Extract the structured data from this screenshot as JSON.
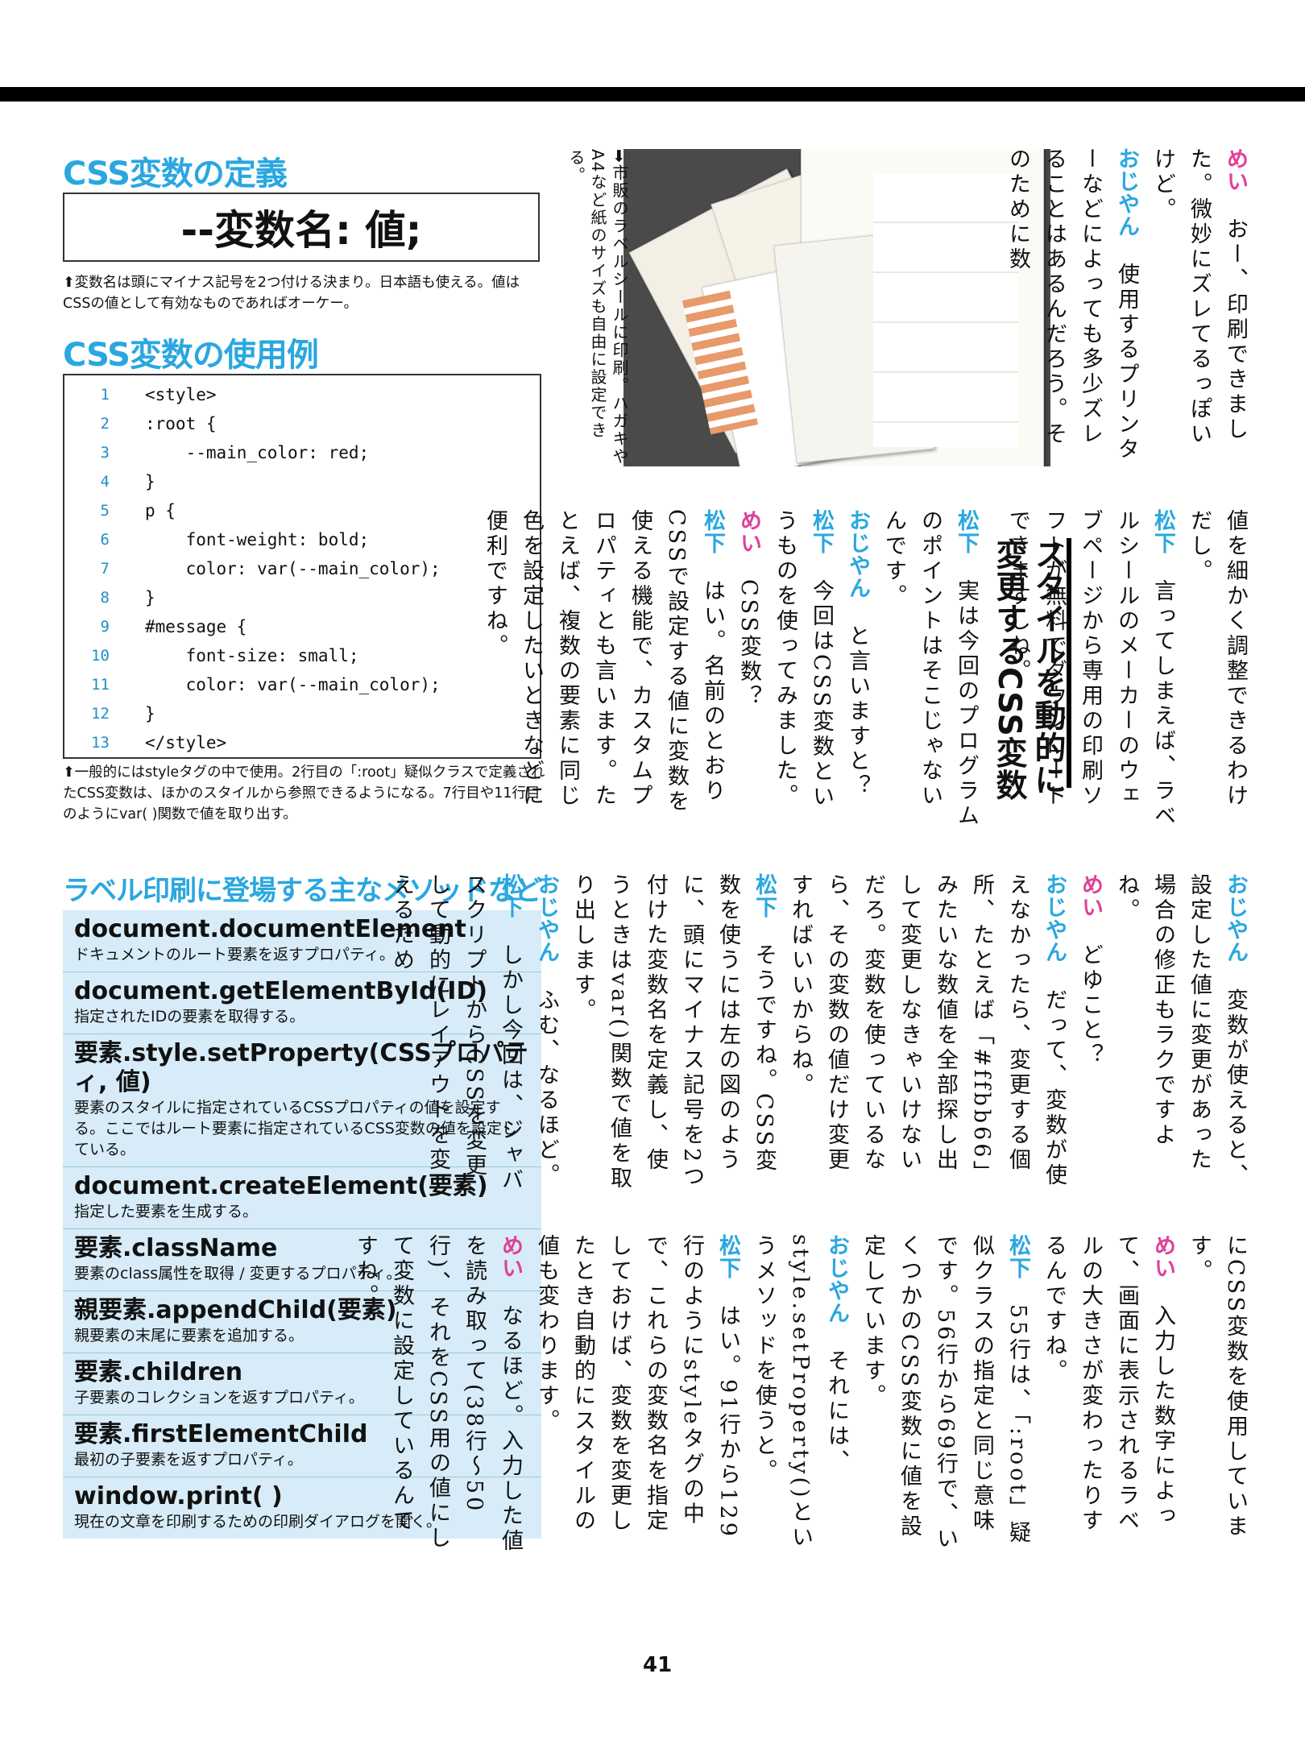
{
  "css_var_definition": {
    "title": "CSS変数の定義",
    "syntax": "--変数名: 値;",
    "caption": "⬆変数名は頭にマイナス記号を2つ付ける決まり。日本語も使える。値はCSSの値として有効なものであればオーケー。"
  },
  "css_var_example": {
    "title": "CSS変数の使用例",
    "code_lines": [
      {
        "num": "1",
        "text": "<style>"
      },
      {
        "num": "2",
        "text": ":root {"
      },
      {
        "num": "3",
        "text": "    --main_color: red;"
      },
      {
        "num": "4",
        "text": "}"
      },
      {
        "num": "5",
        "text": "p {"
      },
      {
        "num": "6",
        "text": "    font-weight: bold;"
      },
      {
        "num": "7",
        "text": "    color: var(--main_color);"
      },
      {
        "num": "8",
        "text": "}"
      },
      {
        "num": "9",
        "text": "#message {"
      },
      {
        "num": "10",
        "text": "    font-size: small;"
      },
      {
        "num": "11",
        "text": "    color: var(--main_color);"
      },
      {
        "num": "12",
        "text": "}"
      },
      {
        "num": "13",
        "text": "</style>"
      }
    ],
    "caption": "⬆一般的にはstyleタグの中で使用。2行目の「:root」疑似クラスで定義されたCSS変数は、ほかのスタイルから参照できるようになる。7行目や11行目のようにvar( )関数で値を取り出す。"
  },
  "methods": {
    "title": "ラベル印刷に登場する主なメソッドなど",
    "items": [
      {
        "name": "document.documentElement",
        "desc": "ドキュメントのルート要素を返すプロパティ。"
      },
      {
        "name": "document.getElementById(ID)",
        "desc": "指定されたIDの要素を取得する。"
      },
      {
        "name": "要素.style.setProperty(CSSプロパティ, 値)",
        "desc": "要素のスタイルに指定されているCSSプロパティの値を設定する。ここではルート要素に指定されているCSS変数の値を設定している。"
      },
      {
        "name": "document.createElement(要素)",
        "desc": "指定した要素を生成する。"
      },
      {
        "name": "要素.className",
        "desc": "要素のclass属性を取得 / 変更するプロパティ。"
      },
      {
        "name": "親要素.appendChild(要素)",
        "desc": "親要素の末尾に要素を追加する。"
      },
      {
        "name": "要素.children",
        "desc": "子要素のコレクションを返すプロパティ。"
      },
      {
        "name": "要素.firstElementChild",
        "desc": "最初の子要素を返すプロパティ。"
      },
      {
        "name": "window.print( )",
        "desc": "現在の文章を印刷するための印刷ダイアログを開く。"
      }
    ]
  },
  "photo": {
    "caption": "➡市販のラベルシールに印刷。ハガキやA4など紙のサイズも自由に設定できる。"
  },
  "article": {
    "heading": "スタイルを動的に変更するCSS変数",
    "block1": [
      {
        "speaker": "めい",
        "text": "おー、印刷できました。微妙にズレてるっぽいけど。"
      },
      {
        "speaker": "おじやん",
        "text": "使用するプリンターなどによっても多少ズレることはあるんだろう。そのために数"
      }
    ],
    "block2a": [
      {
        "speaker": "",
        "text": "値を細かく調整できるわけだし。"
      },
      {
        "speaker": "松下",
        "text": "言ってしまえば、ラベルシールのメーカーのウェブページから専用の印刷ソフトが無料でダウンロードできますしね。"
      }
    ],
    "block2b": [
      {
        "speaker": "松下",
        "text": "実は今回のプログラムのポイントはそこじゃないんです。"
      },
      {
        "speaker": "おじやん",
        "text": "と言いますと？"
      },
      {
        "speaker": "松下",
        "text": "今回はCSS変数というものを使ってみました。"
      },
      {
        "speaker": "めい",
        "text": "CSS変数？"
      },
      {
        "speaker": "松下",
        "text": "はい。名前のとおりCSSで設定する値に変数を使える機能で、カスタムプロパティとも言います。たとえば、複数の要素に同じ色を設定したいときなどに便利ですね。"
      }
    ],
    "block3": [
      {
        "speaker": "おじやん",
        "text": "変数が使えると、設定した値に変更があった場合の修正もラクですよね。"
      },
      {
        "speaker": "めい",
        "text": "どゆこと？"
      },
      {
        "speaker": "おじやん",
        "text": "だって、変数が使えなかったら、変更する個所、たとえば「#ffbb66」みたいな数値を全部探し出して変更しなきゃいけないだろ。変数を使っているなら、その変数の値だけ変更すればいいからね。"
      },
      {
        "speaker": "松下",
        "text": "そうですね。CSS変数を使うには左の図のように、頭にマイナス記号を2つ付けた変数名を定義し、使うときはvar()関数で値を取り出します。"
      },
      {
        "speaker": "おじやん",
        "text": "ふむ、なるほど。"
      },
      {
        "speaker": "松下",
        "text": "しかし今回は、ジャバスクリプトからCSSを変更して動的にレイアウトを変えるため"
      }
    ],
    "block4": [
      {
        "speaker": "",
        "text": "にCSS変数を使用しています。"
      },
      {
        "speaker": "めい",
        "text": "入力した数字によって、画面に表示されるラベルの大きさが変わったりするんですね。"
      },
      {
        "speaker": "松下",
        "text": "55行は、「:root」疑似クラスの指定と同じ意味です。56行から69行で、いくつかのCSS変数に値を設定しています。"
      },
      {
        "speaker": "おじやん",
        "text": "それには、style.setProperty()というメソッドを使うと。"
      },
      {
        "speaker": "松下",
        "text": "はい。91行から129行のようにstyleタグの中で、これらの変数名を指定しておけば、変数を変更したとき自動的にスタイルの値も変わります。"
      },
      {
        "speaker": "めい",
        "text": "なるほど。入力した値を読み取って(38行〜50行)、それをCSS用の値にして変数に設定しているんですね。"
      }
    ]
  },
  "page_number": "41"
}
